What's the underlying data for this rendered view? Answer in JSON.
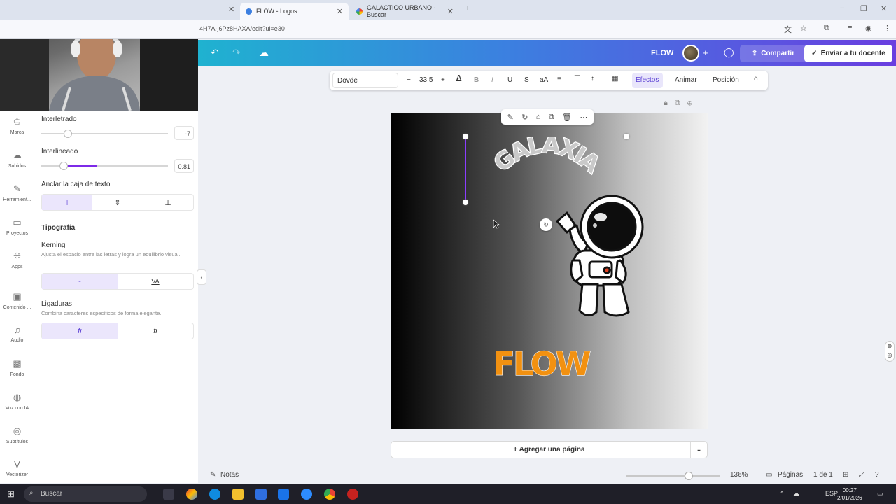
{
  "browser": {
    "tabs": [
      {
        "label": "FLOW - Logos",
        "active": true,
        "favicon_color": "#3c7fe0"
      },
      {
        "label": "GALACTICO URBANO - Buscar",
        "active": false,
        "favicon_color": "#e94235"
      }
    ],
    "new_tab": "+",
    "url": "4H7A-j6Pz8HAXA/edit?ui=e30"
  },
  "header": {
    "project_name": "FLOW",
    "share_label": "Compartir",
    "submit_label": "Enviar a tu docente"
  },
  "toolbar": {
    "font": "Dovde",
    "minus": "−",
    "font_size": "33.5",
    "plus": "+",
    "bold": "B",
    "italic": "I",
    "underline": "U",
    "strike": "S",
    "case": "aA",
    "effects_label": "Efectos",
    "animate_label": "Animar",
    "position_label": "Posición"
  },
  "rail": [
    {
      "label": "Marca",
      "icon": "brand-icon"
    },
    {
      "label": "Subidos",
      "icon": "upload-icon"
    },
    {
      "label": "Herramient...",
      "icon": "draw-icon"
    },
    {
      "label": "Proyectos",
      "icon": "folder-icon"
    },
    {
      "label": "Apps",
      "icon": "apps-icon"
    },
    {
      "label": "Contenido ...",
      "icon": "image-icon"
    },
    {
      "label": "Audio",
      "icon": "music-icon"
    },
    {
      "label": "Fondo",
      "icon": "background-icon"
    },
    {
      "label": "Voz con IA",
      "icon": "voice-icon"
    },
    {
      "label": "Subtítulos",
      "icon": "captions-icon"
    },
    {
      "label": "Vectorizer",
      "icon": "vector-icon"
    }
  ],
  "panel": {
    "letter_spacing_label": "Interletrado",
    "letter_spacing_value": "-7",
    "line_height_label": "Interlineado",
    "line_height_value": "0.81",
    "line_height_level": 0.18,
    "anchor_label": "Anclar la caja de texto",
    "typography_heading": "Tipografía",
    "kerning_label": "Kerning",
    "kerning_desc": "Ajusta el espacio entre las letras y logra un equilibrio visual.",
    "kerning_option_off": "-",
    "kerning_option_on": "VA",
    "ligatures_label": "Ligaduras",
    "ligatures_desc": "Combina caracteres específicos de forma elegante.",
    "ligature_option_a": "fi",
    "ligature_option_b": "fi"
  },
  "design": {
    "arched_text": "GALAXIA",
    "logo_text": "FLOW",
    "logo_color": "#f29111"
  },
  "add_page_label": "+ Agregar una página",
  "footer": {
    "notes_label": "Notas",
    "zoom": "136%",
    "pages_label": "Páginas",
    "page_indicator": "1 de 1"
  },
  "taskbar": {
    "search_placeholder": "Buscar",
    "language": "ESP",
    "time": "00:27",
    "date": "2/01/2026"
  }
}
